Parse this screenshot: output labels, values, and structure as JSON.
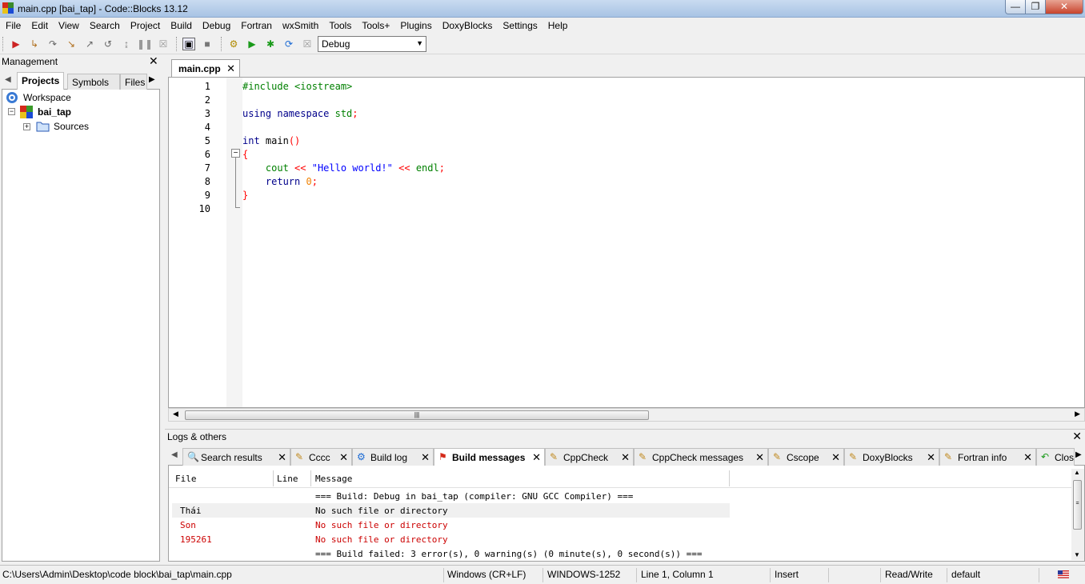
{
  "window": {
    "title": "main.cpp [bai_tap] - Code::Blocks 13.12",
    "min": "0",
    "max": "1",
    "close": "r"
  },
  "menu": [
    "File",
    "Edit",
    "View",
    "Search",
    "Project",
    "Build",
    "Debug",
    "Fortran",
    "wxSmith",
    "Tools",
    "Tools+",
    "Plugins",
    "DoxyBlocks",
    "Settings",
    "Help"
  ],
  "toolbar": {
    "build_target": "Debug"
  },
  "management": {
    "title": "Management",
    "tabs": [
      "Projects",
      "Symbols",
      "Files"
    ],
    "tree": {
      "workspace": "Workspace",
      "project": "bai_tap",
      "folder": "Sources"
    }
  },
  "editor": {
    "tab": "main.cpp",
    "line_numbers": [
      "1",
      "2",
      "3",
      "4",
      "5",
      "6",
      "7",
      "8",
      "9",
      "10"
    ],
    "lines": [
      "#include <iostream>",
      "",
      "using namespace std;",
      "",
      "int main()",
      "{",
      "    cout << \"Hello world!\" << endl;",
      "    return 0;",
      "}",
      ""
    ]
  },
  "logs": {
    "title": "Logs & others",
    "tabs": [
      "Search results",
      "Cccc",
      "Build log",
      "Build messages",
      "CppCheck",
      "CppCheck messages",
      "Cscope",
      "DoxyBlocks",
      "Fortran info",
      "Clos"
    ],
    "active_tab": "Build messages",
    "columns": [
      "File",
      "Line",
      "Message"
    ],
    "rows": [
      {
        "file": "",
        "line": "",
        "message": "=== Build: Debug in bai_tap (compiler: GNU GCC Compiler) ==="
      },
      {
        "file": "Thái",
        "line": "",
        "message": "No such file or directory"
      },
      {
        "file": "Son",
        "line": "",
        "message": "No such file or directory"
      },
      {
        "file": "195261",
        "line": "",
        "message": "No such file or directory"
      },
      {
        "file": "",
        "line": "",
        "message": "=== Build failed: 3 error(s), 0 warning(s) (0 minute(s), 0 second(s)) ==="
      }
    ],
    "colors": {
      "error": "#cc0000",
      "normal": "#000000"
    }
  },
  "status": {
    "path": "C:\\Users\\Admin\\Desktop\\code block\\bai_tap\\main.cpp",
    "eol": "Windows (CR+LF)",
    "encoding": "WINDOWS-1252",
    "position": "Line 1, Column 1",
    "mode": "Insert",
    "access": "Read/Write",
    "profile": "default"
  },
  "icons": [
    "codeblocks-app-icon",
    "run-icon",
    "debug-icon",
    "build-icon",
    "rebuild-icon",
    "abort-icon",
    "workspace-icon",
    "project-icon",
    "folder-icon",
    "search-icon",
    "flag-icon"
  ]
}
